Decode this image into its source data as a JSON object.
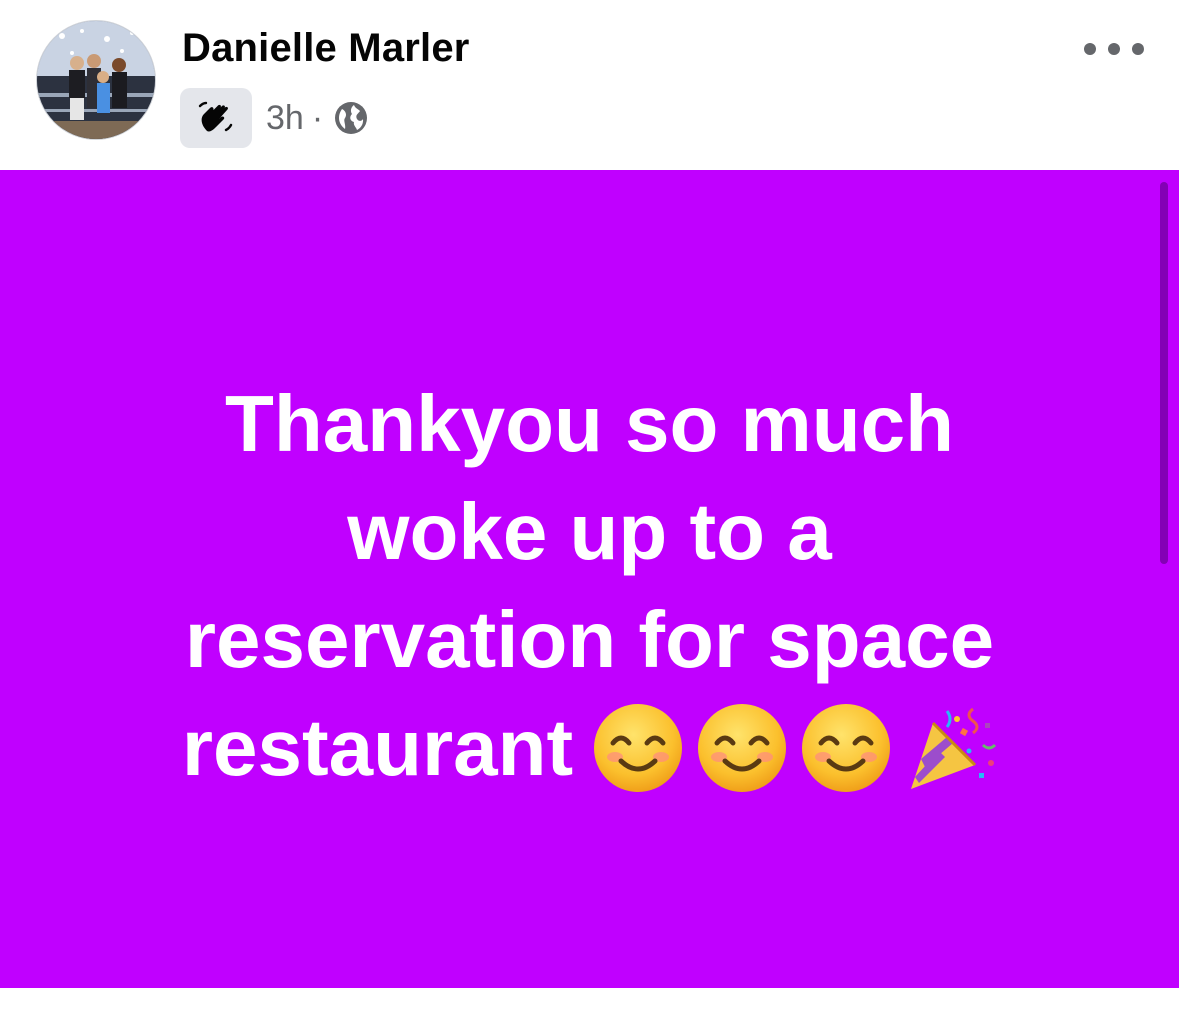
{
  "post": {
    "author": "Danielle Marler",
    "timestamp": "3h",
    "separator": "·",
    "audience_icon": "globe-icon",
    "badge_icon": "waving-hand-icon",
    "status_text_lines": [
      "Thankyou so much",
      "woke up to a",
      "reservation for space",
      "restaurant"
    ],
    "emojis": [
      "smiling-face-emoji",
      "smiling-face-emoji",
      "smiling-face-emoji",
      "party-popper-emoji"
    ],
    "background_color": "#c000ff",
    "text_color": "#ffffff"
  },
  "colors": {
    "name": "#050505",
    "meta": "#65676b",
    "badge_bg": "#e4e6eb"
  }
}
